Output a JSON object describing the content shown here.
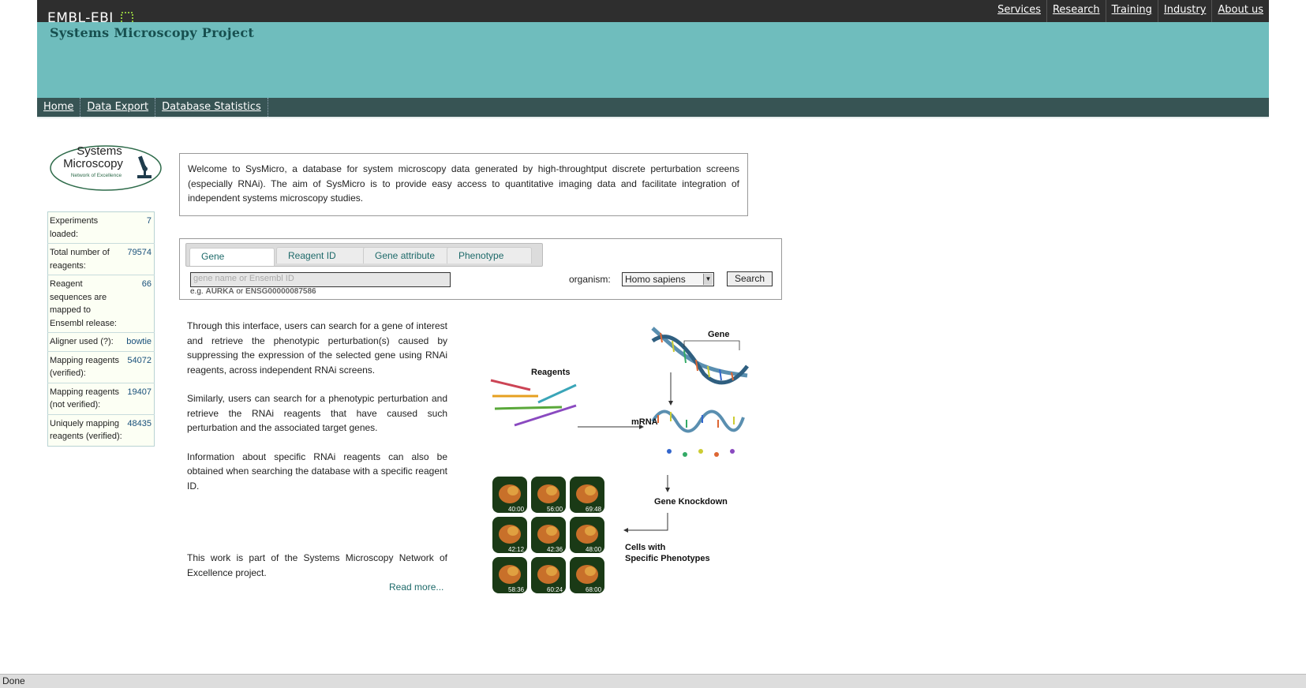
{
  "global": {
    "logo_text": "EMBL-EBI",
    "nav": [
      "Services",
      "Research",
      "Training",
      "Industry",
      "About us"
    ]
  },
  "project": {
    "title": "Systems Microscopy Project"
  },
  "local_nav": [
    "Home",
    "Data Export",
    "Database Statistics"
  ],
  "sidebar": {
    "logo_lines": [
      "Systems",
      "Microscopy",
      "Network of Excellence"
    ],
    "stats": [
      {
        "label": "Experiments loaded:",
        "value": "7"
      },
      {
        "label": "Total number of reagents:",
        "value": "79574"
      },
      {
        "label": "Reagent sequences are mapped to Ensembl release:",
        "value": "66"
      },
      {
        "label": "Aligner used (?):",
        "value": "bowtie"
      },
      {
        "label": "Mapping reagents (verified):",
        "value": "54072"
      },
      {
        "label": "Mapping reagents (not verified):",
        "value": "19407"
      },
      {
        "label": "Uniquely mapping reagents (verified):",
        "value": "48435"
      }
    ]
  },
  "welcome": "Welcome to SysMicro, a database for system microscopy data generated by high-throughtput discrete perturbation screens (especially RNAi). The aim of SysMicro is to provide easy access to quantitative imaging data and facilitate integration of independent systems microscopy studies.",
  "search": {
    "tabs": [
      "Gene",
      "Reagent ID",
      "Gene attribute",
      "Phenotype"
    ],
    "active_tab": "Gene",
    "placeholder": "gene name or Ensembl ID",
    "example_prefix": "e.g.",
    "example_1": "AURKA",
    "example_or": "or",
    "example_2": "ENSG00000087586",
    "organism_label": "organism:",
    "organism_value": "Homo sapiens",
    "button": "Search"
  },
  "intro": {
    "p1": "Through this interface, users can search for a gene of interest and retrieve the phenotypic perturbation(s) caused by suppressing the expression of the selected gene using RNAi reagents, across independent RNAi screens.",
    "p2": "Similarly, users can search for a phenotypic perturbation and retrieve the RNAi reagents that have caused such perturbation and the associated target genes.",
    "p3": "Information about specific RNAi reagents can also be obtained when searching the database with a specific reagent ID.",
    "p4": "This work is part of the Systems Microscopy Network of Excellence project.",
    "read_more": "Read more..."
  },
  "diagram": {
    "labels": {
      "gene": "Gene",
      "reagents": "Reagents",
      "mrna": "mRNA",
      "knockdown": "Gene Knockdown",
      "cells_line1": "Cells with",
      "cells_line2": "Specific Phenotypes"
    },
    "timestamps": [
      "40:00",
      "56:00",
      "69:48",
      "42:12",
      "42:36",
      "48:00",
      "58:36",
      "60:24",
      "68:00"
    ]
  },
  "status": "Done",
  "colors": {
    "topbar": "#2e2e2e",
    "header": "#6fbdbd",
    "local_nav": "#375454",
    "link_teal": "#1e6a6a"
  }
}
